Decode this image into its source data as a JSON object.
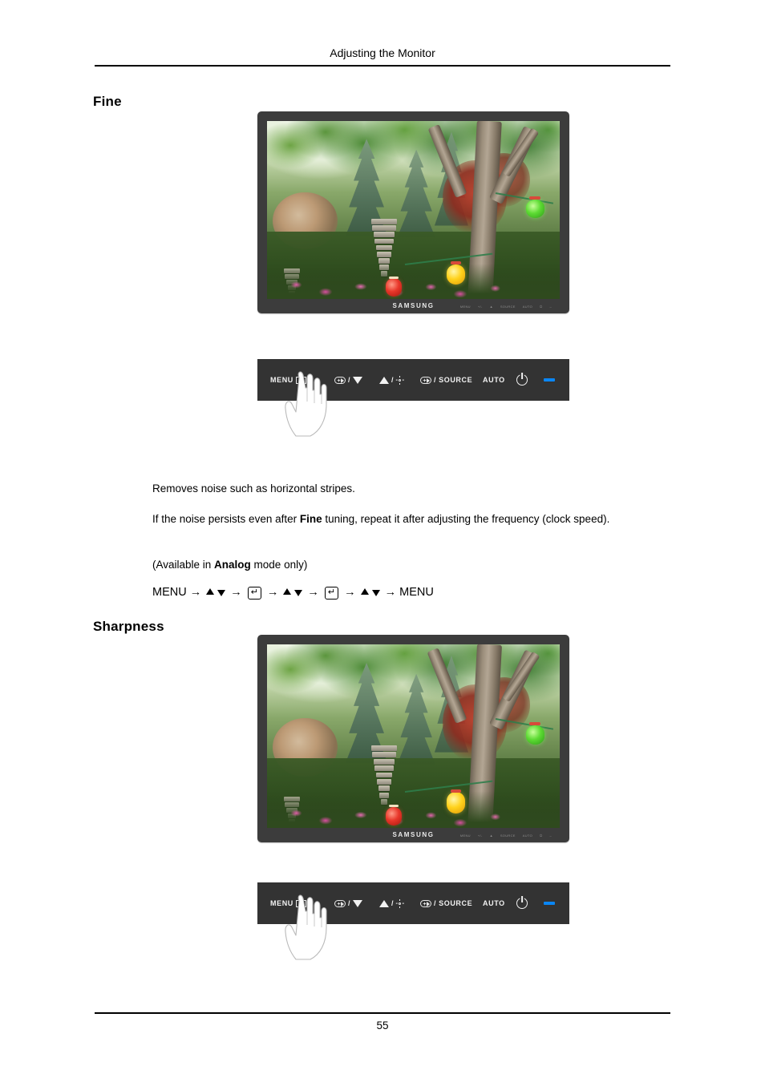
{
  "document": {
    "header_title": "Adjusting the Monitor",
    "page_number": "55"
  },
  "sections": [
    {
      "id": "fine",
      "heading": "Fine",
      "paragraphs": [
        {
          "id": "p1",
          "text": "Removes noise such as horizontal stripes."
        },
        {
          "id": "p2_a",
          "text": "If the noise persists even after "
        },
        {
          "id": "p2_b_bold",
          "text": "Fine"
        },
        {
          "id": "p2_c",
          "text": " tuning, repeat it after adjusting the frequency (clock speed)."
        },
        {
          "id": "p3_a",
          "text": "(Available in "
        },
        {
          "id": "p3_b_bold",
          "text": "Analog"
        },
        {
          "id": "p3_c",
          "text": " mode only)"
        }
      ],
      "nav_sequence": {
        "start_label": "MENU",
        "end_label": "MENU",
        "steps": [
          "arrow-right",
          "up-arrow",
          "down-arrow",
          "arrow-right",
          "enter-key",
          "arrow-right",
          "up-arrow",
          "down-arrow",
          "arrow-right",
          "enter-key",
          "arrow-right",
          "up-arrow",
          "down-arrow",
          "arrow-right"
        ]
      }
    },
    {
      "id": "sharpness",
      "heading": "Sharpness"
    }
  ],
  "monitor": {
    "brand": "SAMSUNG",
    "screen_caption": "Garden scene with stone pagoda, trees and paper lanterns",
    "bezel_color": "#3c3c3c",
    "chin_keys": [
      "MENU",
      "+/-",
      "▲",
      "SOURCE",
      "AUTO",
      "⏻",
      "–"
    ]
  },
  "control_panel": {
    "background_color": "#333333",
    "led_color": "#0a86f5",
    "buttons": [
      {
        "name": "menu-button",
        "label": "MENU",
        "icon": "menu-grid-icon"
      },
      {
        "name": "enter-down-button",
        "label": "",
        "icon": "enter-pill-icon",
        "separator": "/",
        "icon2": "down-triangle-icon"
      },
      {
        "name": "up-brightness-button",
        "label": "",
        "icon": "up-triangle-icon",
        "separator": "/",
        "icon2": "brightness-sun-icon"
      },
      {
        "name": "source-button",
        "label": "SOURCE",
        "icon": "enter-pill-icon",
        "separator": "/"
      },
      {
        "name": "auto-button",
        "label": "AUTO",
        "icon": ""
      },
      {
        "name": "power-button",
        "label": "",
        "icon": "power-icon"
      },
      {
        "name": "power-led",
        "label": "",
        "icon": "led-indicator-icon"
      }
    ],
    "pointer": "hand-pointing-icon"
  }
}
